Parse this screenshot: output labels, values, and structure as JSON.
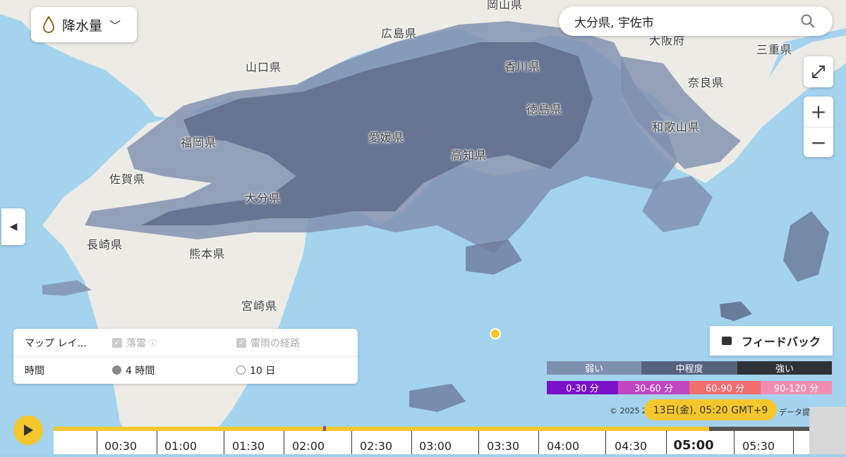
{
  "layer_select": {
    "label": "降水量",
    "icon": "raindrop-icon"
  },
  "search": {
    "value": "大分県, 宇佐市",
    "placeholder": "",
    "icon": "search-icon"
  },
  "map_labels": [
    {
      "key": "hiroshima",
      "text": "広島県"
    },
    {
      "key": "okayama",
      "text": "岡山県"
    },
    {
      "key": "osaka",
      "text": "大阪府"
    },
    {
      "key": "mie",
      "text": "三重県"
    },
    {
      "key": "yamaguchi",
      "text": "山口県"
    },
    {
      "key": "kagawa",
      "text": "香川県"
    },
    {
      "key": "nara",
      "text": "奈良県"
    },
    {
      "key": "tokushima",
      "text": "徳島県"
    },
    {
      "key": "wakayama",
      "text": "和歌山県"
    },
    {
      "key": "fukuoka",
      "text": "福岡県"
    },
    {
      "key": "ehime",
      "text": "愛媛県"
    },
    {
      "key": "kochi",
      "text": "高知県"
    },
    {
      "key": "saga",
      "text": "佐賀県"
    },
    {
      "key": "oita",
      "text": "大分県"
    },
    {
      "key": "nagasaki",
      "text": "長崎県"
    },
    {
      "key": "kumamoto",
      "text": "熊本県"
    },
    {
      "key": "miyazaki",
      "text": "宮崎県"
    }
  ],
  "layers_panel": {
    "map_layers_label": "マップ レイ...",
    "lightning_label": "落雷",
    "storm_path_label": "雷雨の経路",
    "time_label": "時間",
    "option_4h": "4 時間",
    "option_10d": "10 日",
    "selected": "4 時間"
  },
  "feedback": {
    "label": "フィードバック"
  },
  "legend": {
    "intensity": [
      {
        "label": "弱い",
        "color": "#7f8fae"
      },
      {
        "label": "中程度",
        "color": "#54627e"
      },
      {
        "label": "強い",
        "color": "#2f3236"
      }
    ],
    "duration": [
      {
        "label": "0-30 分",
        "color": "#7a12c8"
      },
      {
        "label": "30-60 分",
        "color": "#c046c0"
      },
      {
        "label": "60-90 分",
        "color": "#f26d6d"
      },
      {
        "label": "90-120 分",
        "color": "#f08cb2"
      }
    ]
  },
  "copyright": "© 2025 Z",
  "data_credit": "データ提供元",
  "tooltip": "13日(金), 05:20 GMT+9",
  "timeline": {
    "progress": 0.867,
    "ticks": [
      "00:30",
      "01:00",
      "01:30",
      "02:00",
      "02:30",
      "03:00",
      "03:30",
      "04:00",
      "04:30",
      "05:00",
      "05:30"
    ],
    "current": "05:00"
  },
  "colors": {
    "accent": "#f3c72d",
    "sea": "#9fd0ec",
    "land": "#ecebe6"
  }
}
